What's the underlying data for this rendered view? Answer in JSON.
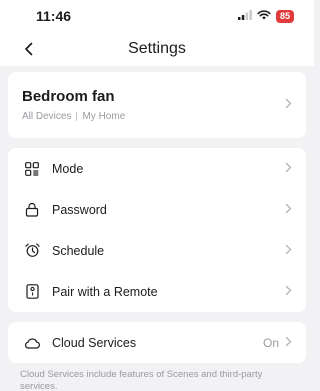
{
  "status_bar": {
    "time": "11:46",
    "battery": "85",
    "icons": [
      "signal-icon",
      "wifi-icon",
      "battery-icon"
    ]
  },
  "nav": {
    "title": "Settings",
    "back_icon": "chevron-left-icon"
  },
  "device": {
    "name": "Bedroom fan",
    "location_primary": "All Devices",
    "location_secondary": "My Home"
  },
  "menu": [
    {
      "label": "Mode",
      "icon": "grid-list-icon"
    },
    {
      "label": "Password",
      "icon": "lock-icon"
    },
    {
      "label": "Schedule",
      "icon": "alarm-clock-icon"
    },
    {
      "label": "Pair with a Remote",
      "icon": "remote-icon"
    }
  ],
  "cloud": {
    "label": "Cloud Services",
    "value": "On",
    "icon": "cloud-icon",
    "note": "Cloud Services include features of Scenes and third-party services."
  }
}
